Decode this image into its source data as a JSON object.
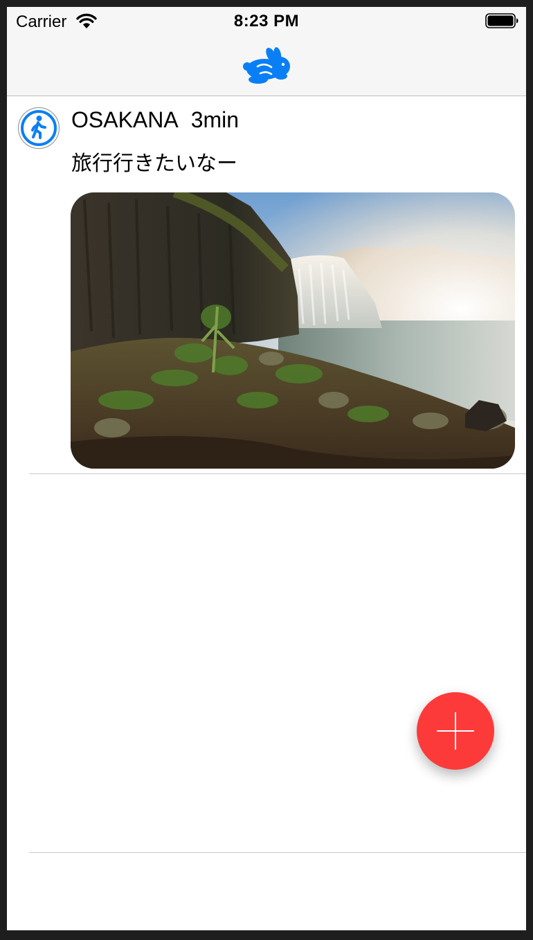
{
  "status_bar": {
    "carrier": "Carrier",
    "time": "8:23 PM",
    "wifi_icon": "wifi-icon",
    "battery_icon": "battery-full-icon"
  },
  "nav_bar": {
    "logo_icon": "rabbit-logo-icon"
  },
  "feed": {
    "posts": [
      {
        "avatar_icon": "accessibility-walking-icon",
        "user_name": "OSAKANA",
        "time_ago": "3min",
        "text": "旅行行きたいなー",
        "image": "waterfall-photo"
      }
    ]
  },
  "fab": {
    "icon": "plus-icon",
    "color": "#fc3a3a"
  },
  "colors": {
    "accent": "#0a7ff5",
    "fab": "#fc3a3a",
    "bar_background": "#f6f6f6"
  }
}
